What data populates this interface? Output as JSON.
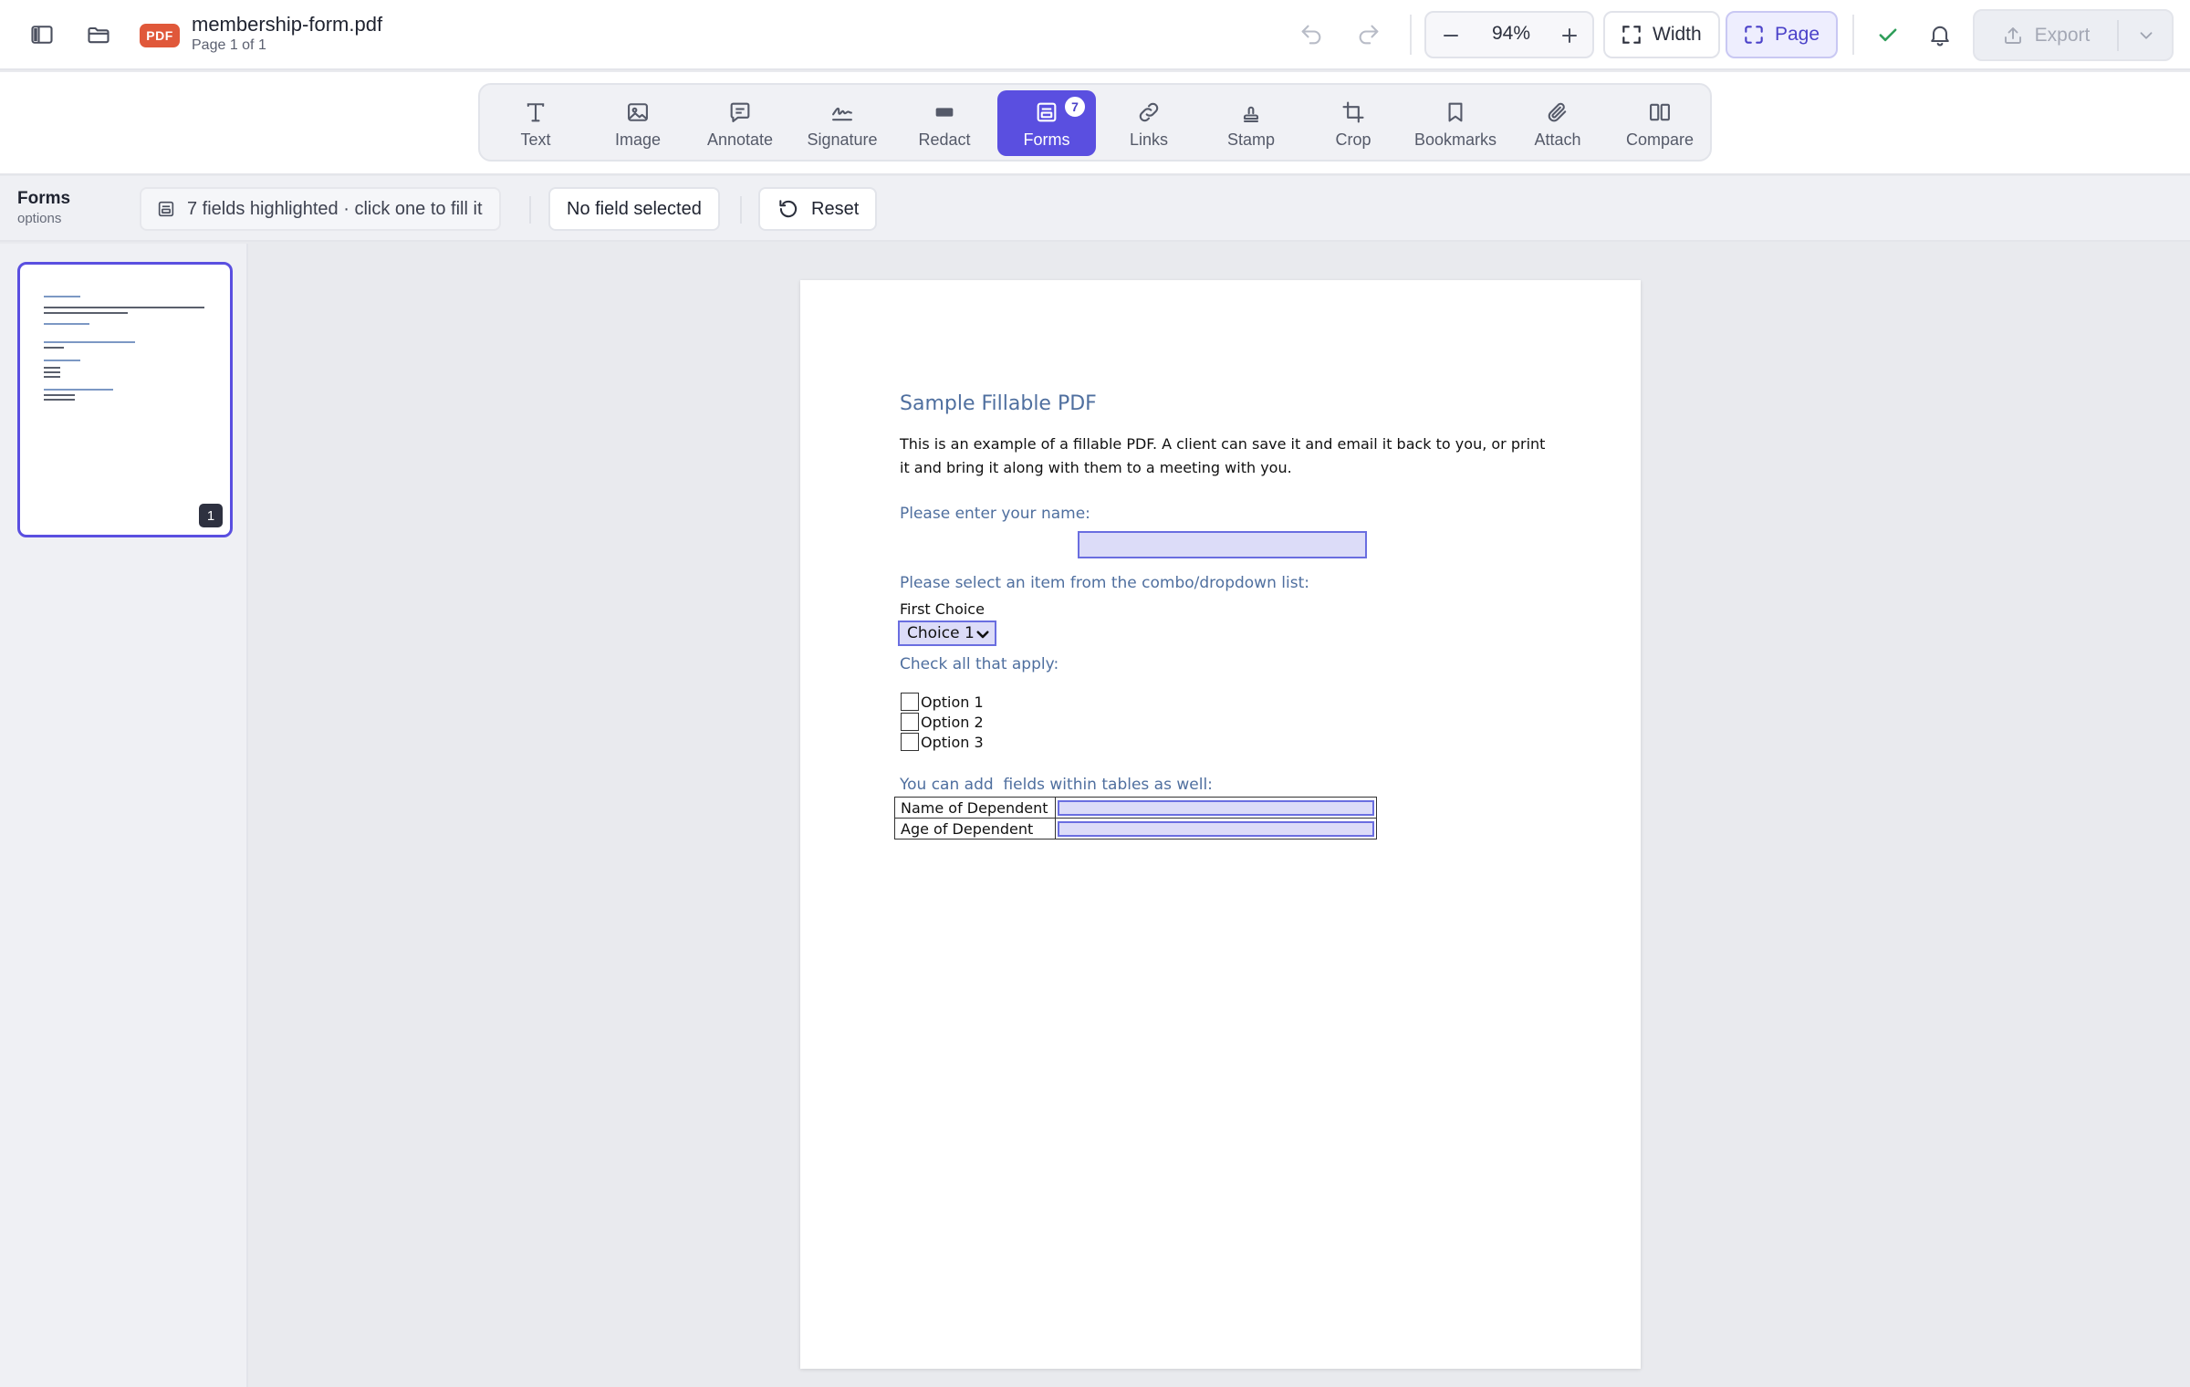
{
  "header": {
    "file_badge": "PDF",
    "file_name": "membership-form.pdf",
    "page_info": "Page 1 of 1",
    "zoom": "94%",
    "fit_width_label": "Width",
    "fit_page_label": "Page",
    "export_label": "Export"
  },
  "tools": [
    {
      "label": "Text",
      "icon": "text-icon"
    },
    {
      "label": "Image",
      "icon": "image-icon"
    },
    {
      "label": "Annotate",
      "icon": "comment-icon"
    },
    {
      "label": "Signature",
      "icon": "signature-icon"
    },
    {
      "label": "Redact",
      "icon": "redact-icon"
    },
    {
      "label": "Forms",
      "icon": "form-icon",
      "active": true,
      "badge": "7"
    },
    {
      "label": "Links",
      "icon": "link-icon"
    },
    {
      "label": "Stamp",
      "icon": "stamp-icon"
    },
    {
      "label": "Crop",
      "icon": "crop-icon"
    },
    {
      "label": "Bookmarks",
      "icon": "bookmark-icon"
    },
    {
      "label": "Attach",
      "icon": "paperclip-icon"
    },
    {
      "label": "Compare",
      "icon": "compare-icon"
    }
  ],
  "options": {
    "title": "Forms",
    "subtitle": "options",
    "fields_info": "7 fields highlighted · click one to fill it",
    "selection": "No field selected",
    "reset_label": "Reset"
  },
  "sidebar": {
    "page_number": "1"
  },
  "document": {
    "heading": "Sample Fillable PDF",
    "intro": "This is an example of a fillable PDF. A client can save it and email it back to you, or print it and bring it along with them to a meeting with you.",
    "name_prompt": "Please enter your name:",
    "combo_prompt": "Please select an item from the combo/dropdown list:",
    "combo_caption": "First Choice",
    "combo_value": "Choice 1",
    "check_prompt": "Check all that apply:",
    "options": [
      "Option 1",
      "Option 2",
      "Option 3"
    ],
    "table_prompt": "You can add  fields within tables as well:",
    "table_rows": [
      "Name of Dependent",
      "Age of Dependent"
    ]
  },
  "colors": {
    "accent": "#5a4fe0",
    "pdf_badge": "#e0583a",
    "pdf_heading": "#4f6f9f",
    "field_fill": "#dcdcf8",
    "confirm": "#2f9e5a"
  }
}
